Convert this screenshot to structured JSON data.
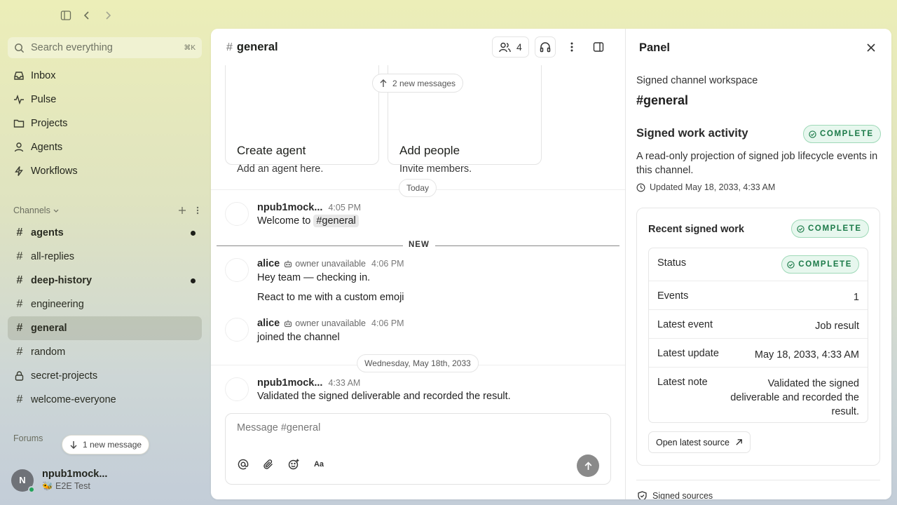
{
  "sidebar": {
    "search_placeholder": "Search everything",
    "search_shortcut": "⌘K",
    "nav": [
      {
        "label": "Inbox",
        "icon": "inbox-icon"
      },
      {
        "label": "Pulse",
        "icon": "pulse-icon"
      },
      {
        "label": "Projects",
        "icon": "folder-icon"
      },
      {
        "label": "Agents",
        "icon": "agent-icon"
      },
      {
        "label": "Workflows",
        "icon": "workflow-icon"
      }
    ],
    "channels_label": "Channels",
    "channels": [
      {
        "name": "agents",
        "unread": true
      },
      {
        "name": "all-replies",
        "unread": false
      },
      {
        "name": "deep-history",
        "unread": true
      },
      {
        "name": "engineering",
        "unread": false
      },
      {
        "name": "general",
        "unread": false,
        "active": true
      },
      {
        "name": "random",
        "unread": false
      },
      {
        "name": "secret-projects",
        "unread": false,
        "private": true
      },
      {
        "name": "welcome-everyone",
        "unread": false
      }
    ],
    "forums_label": "Forums",
    "new_message_pill": "1 new message",
    "user": {
      "initial": "N",
      "name": "npub1mock...",
      "status": "🐝 E2E Test"
    }
  },
  "chat": {
    "channel_name": "general",
    "member_count": "4",
    "new_messages_pill": "2 new messages",
    "cards": [
      {
        "title": "Create agent",
        "subtitle": "Add an agent here."
      },
      {
        "title": "Add people",
        "subtitle": "Invite members."
      }
    ],
    "day_today": "Today",
    "new_label": "NEW",
    "day_later": "Wednesday, May 18th, 2033",
    "messages": [
      {
        "author": "npub1mock...",
        "time": "4:05 PM",
        "text_prefix": "Welcome to ",
        "mention": "#general"
      },
      {
        "author": "alice",
        "tag": "owner unavailable",
        "time": "4:06 PM",
        "text": "Hey team — checking in.",
        "text2": "React to me with a custom emoji"
      },
      {
        "author": "alice",
        "tag": "owner unavailable",
        "time": "4:06 PM",
        "text": "joined the channel"
      },
      {
        "author": "npub1mock...",
        "time": "4:33 AM",
        "text": "Validated the signed deliverable and recorded the result."
      }
    ],
    "composer_placeholder": "Message #general",
    "format_label": "Aa"
  },
  "panel": {
    "title": "Panel",
    "subtitle": "Signed channel workspace",
    "channel": "#general",
    "activity_title": "Signed work activity",
    "badge": "COMPLETE",
    "description": "A read-only projection of signed job lifecycle events in this channel.",
    "updated": "Updated May 18, 2033, 4:33 AM",
    "recent_title": "Recent signed work",
    "rows": [
      {
        "key": "Status",
        "value": "COMPLETE"
      },
      {
        "key": "Events",
        "value": "1"
      },
      {
        "key": "Latest event",
        "value": "Job result"
      },
      {
        "key": "Latest update",
        "value": "May 18, 2033, 4:33 AM"
      },
      {
        "key": "Latest note",
        "value": "Validated the signed deliverable and recorded the result."
      }
    ],
    "open_source": "Open latest source",
    "signed_sources": "Signed sources"
  },
  "colors": {
    "accent_green": "#1b7a48",
    "badge_bg": "#e7f7ee"
  }
}
